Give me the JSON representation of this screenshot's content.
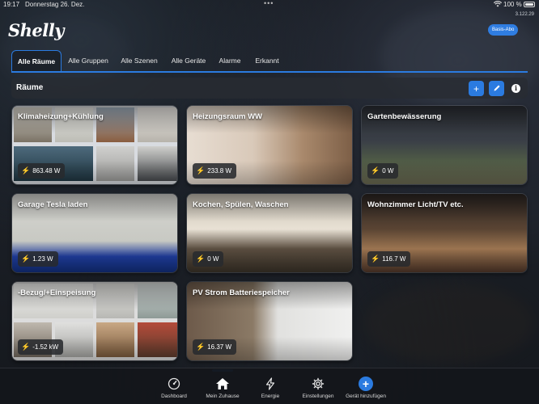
{
  "status_bar": {
    "time": "19:17",
    "date": "Donnerstag 26. Dez.",
    "battery": "100 %",
    "wifi_icon": "wifi-icon"
  },
  "app": {
    "version": "3.122.29",
    "logo": "Shelly",
    "plan_badge": "Basis-Abo",
    "accent_color": "#2b7be0"
  },
  "tabs": [
    {
      "label": "Alle Räume",
      "active": true
    },
    {
      "label": "Alle Gruppen",
      "active": false
    },
    {
      "label": "Alle Szenen",
      "active": false
    },
    {
      "label": "Alle Geräte",
      "active": false
    },
    {
      "label": "Alarme",
      "active": false
    },
    {
      "label": "Erkannt",
      "active": false
    }
  ],
  "section": {
    "title": "Räume",
    "actions": [
      "plus-icon",
      "pencil-icon",
      "info-icon"
    ]
  },
  "rooms": [
    {
      "name": "Klimaheizung+Kühlung",
      "power": "863.48 W"
    },
    {
      "name": "Heizungsraum WW",
      "power": "233.8 W"
    },
    {
      "name": "Gartenbewässerung",
      "power": "0 W"
    },
    {
      "name": "Garage Tesla laden",
      "power": "1.23 W"
    },
    {
      "name": "Kochen, Spülen, Waschen",
      "power": "0 W"
    },
    {
      "name": "Wohnzimmer Licht/TV etc.",
      "power": "116.7 W"
    },
    {
      "name": "-Bezug/+Einspeisung",
      "power": "-1.52 kW"
    },
    {
      "name": "PV Strom Batteriespeicher",
      "power": "16.37 W"
    }
  ],
  "bottom_nav": [
    {
      "label": "Dashboard",
      "icon": "gauge-icon",
      "active": false
    },
    {
      "label": "Mein Zuhause",
      "icon": "home-icon",
      "active": true
    },
    {
      "label": "Energie",
      "icon": "bolt-icon",
      "active": false
    },
    {
      "label": "Einstellungen",
      "icon": "gear-icon",
      "active": false
    },
    {
      "label": "Gerät hinzufügen",
      "icon": "plus-circle-icon",
      "active": false
    }
  ]
}
